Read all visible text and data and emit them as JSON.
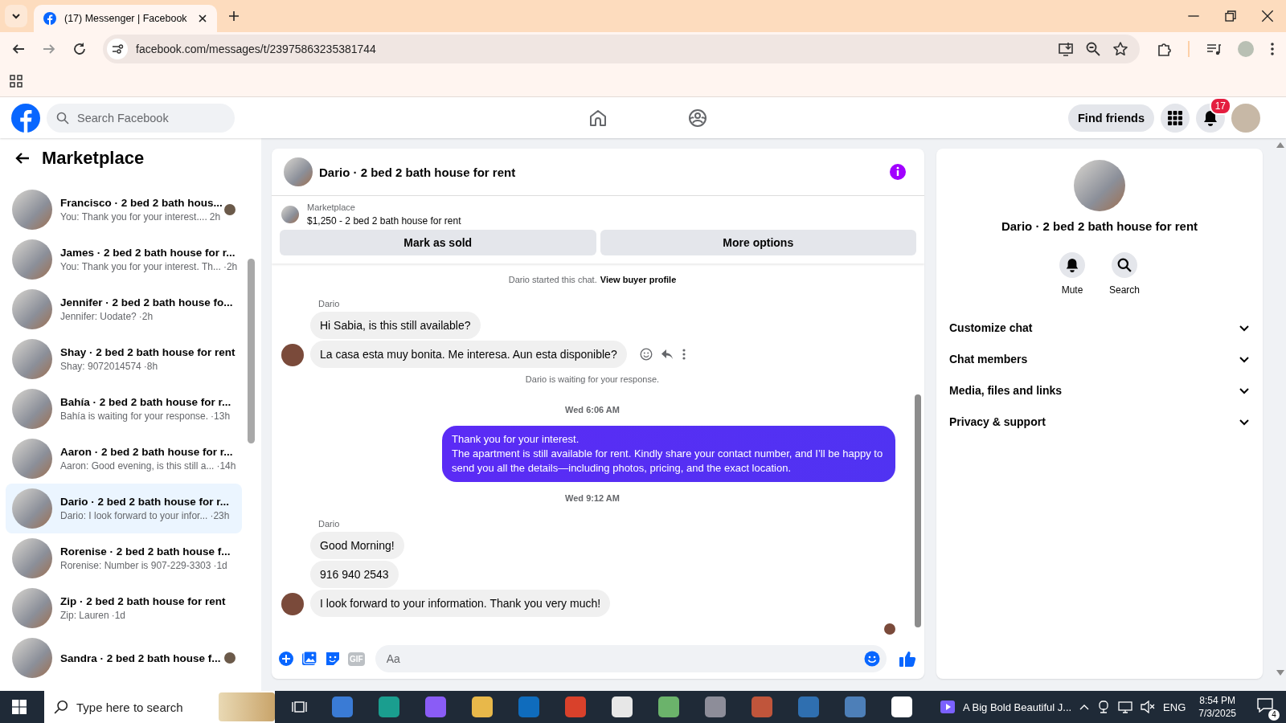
{
  "browser": {
    "tab_title": "(17) Messenger | Facebook",
    "url": "facebook.com/messages/t/23975863235381744"
  },
  "header": {
    "search_placeholder": "Search Facebook",
    "find_friends": "Find friends",
    "notification_count": "17"
  },
  "sidebar": {
    "title": "Marketplace",
    "conversations": [
      {
        "title": "Francisco · 2 bed 2 bath hous...",
        "preview": "You: Thank you for your interest....",
        "time": "2h",
        "selected": false,
        "seen": true
      },
      {
        "title": "James · 2 bed 2 bath house for r...",
        "preview": "You: Thank you for your interest. Th...",
        "time": "·2h",
        "selected": false,
        "seen": false
      },
      {
        "title": "Jennifer · 2 bed 2 bath house fo...",
        "preview": "Jennifer: Uodate?",
        "time": "·2h",
        "selected": false,
        "seen": false
      },
      {
        "title": "Shay · 2 bed 2 bath house for rent",
        "preview": "Shay: 9072014574",
        "time": "·8h",
        "selected": false,
        "seen": false
      },
      {
        "title": "Bahía · 2 bed 2 bath house for r...",
        "preview": "Bahía is waiting for your response.",
        "time": "·13h",
        "selected": false,
        "seen": false
      },
      {
        "title": "Aaron · 2 bed 2 bath house for r...",
        "preview": "Aaron: Good evening, is this still a...",
        "time": "·14h",
        "selected": false,
        "seen": false
      },
      {
        "title": "Dario · 2 bed 2 bath house for r...",
        "preview": "Dario: I look forward to your infor...",
        "time": "·23h",
        "selected": true,
        "seen": false
      },
      {
        "title": "Rorenise · 2 bed 2 bath house f...",
        "preview": "Rorenise: Number is 907-229-3303",
        "time": "·1d",
        "selected": false,
        "seen": false
      },
      {
        "title": "Zip · 2 bed 2 bath house for rent",
        "preview": "Zip: Lauren",
        "time": "·1d",
        "selected": false,
        "seen": false
      },
      {
        "title": "Sandra · 2 bed 2 bath house f...",
        "seen": true,
        "selected": false
      }
    ]
  },
  "chat": {
    "title": "Dario · 2 bed 2 bath house for rent",
    "listing": {
      "source": "Marketplace",
      "title": "$1,250 - 2 bed 2 bath house for rent"
    },
    "actions": [
      "Mark as sold",
      "More options"
    ],
    "messages": [
      {
        "kind": "notice",
        "text": "Dario started this chat.",
        "link": "View buyer profile"
      },
      {
        "kind": "sender",
        "text": "Dario"
      },
      {
        "kind": "incoming",
        "text": "Hi Sabia, is this still available?",
        "avatar": false,
        "reactions": false
      },
      {
        "kind": "incoming",
        "text": "La casa esta muy bonita. Me interesa. Aun esta disponible?",
        "avatar": true,
        "reactions": true
      },
      {
        "kind": "notice",
        "text": "Dario is waiting for your response."
      },
      {
        "kind": "time",
        "text": "Wed 6:06 AM"
      },
      {
        "kind": "outgoing",
        "text": "Thank you for your interest.\nThe apartment is still available for rent. Kindly share your contact number, and I’ll be happy to send you all the details—including photos, pricing, and the exact location."
      },
      {
        "kind": "time",
        "text": "Wed 9:12 AM"
      },
      {
        "kind": "sender",
        "text": "Dario"
      },
      {
        "kind": "incoming",
        "text": "Good Morning!",
        "avatar": false,
        "reactions": false
      },
      {
        "kind": "incoming",
        "text": "916 940 2543",
        "avatar": false,
        "reactions": false
      },
      {
        "kind": "incoming",
        "text": "I look forward to your information. Thank you very much!",
        "avatar": true,
        "reactions": false
      }
    ],
    "composer": {
      "gif_label": "GIF",
      "placeholder": "Aa"
    }
  },
  "details": {
    "title": "Dario · 2 bed 2 bath house for rent",
    "actions": [
      {
        "label": "Mute",
        "kind": "bell"
      },
      {
        "label": "Search",
        "kind": "search"
      }
    ],
    "sections": [
      "Customize chat",
      "Chat members",
      "Media, files and links",
      "Privacy & support"
    ]
  },
  "taskbar": {
    "search_placeholder": "Type here to search",
    "media": "A Big Bold Beautiful J...",
    "language": "ENG",
    "time": "8:54 PM",
    "date": "7/3/2025",
    "notifications": "4"
  }
}
